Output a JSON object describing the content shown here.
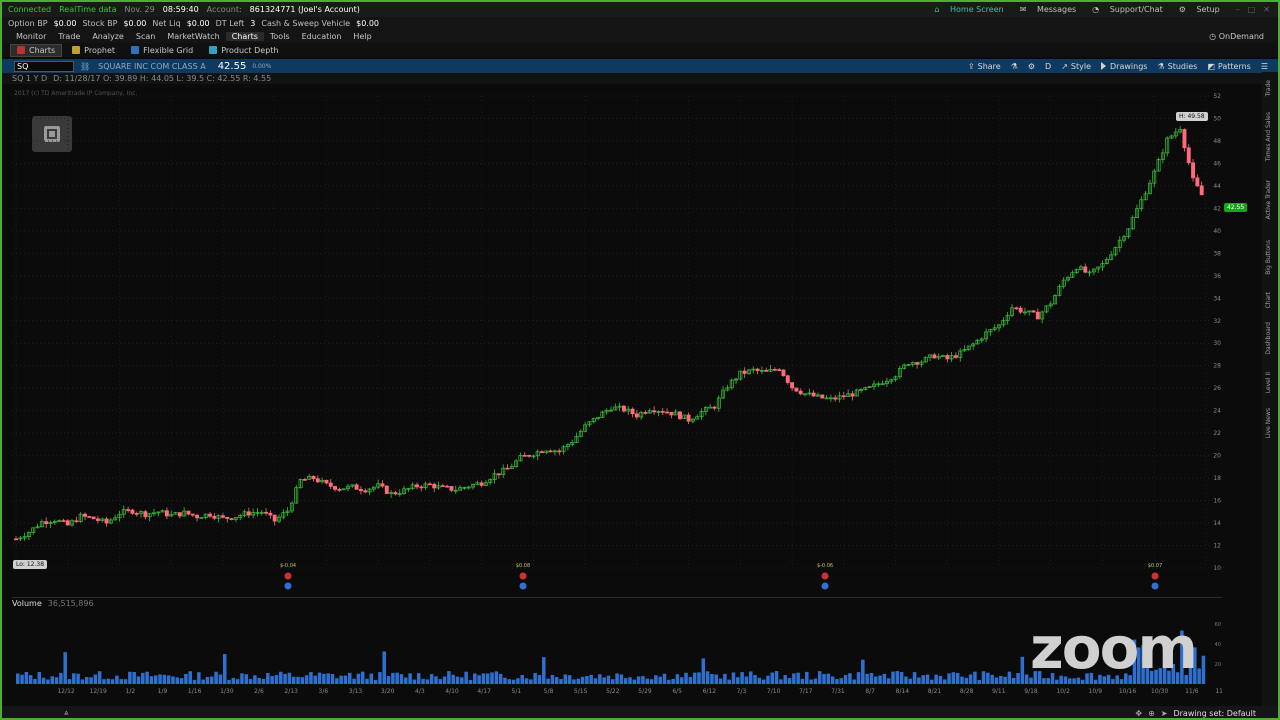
{
  "status": {
    "connected": "Connected",
    "realtime": "RealTime data",
    "datetime": "Nov. 29",
    "time": "08:59:40",
    "account_label": "Account:",
    "account": "861324771 (Joel's Account)",
    "home_screen": "Home Screen",
    "messages": "Messages",
    "support": "Support/Chat",
    "setup": "Setup"
  },
  "bp": {
    "option_bp_label": "Option BP",
    "option_bp": "$0.00",
    "stock_bp_label": "Stock BP",
    "stock_bp": "$0.00",
    "net_liq_label": "Net Liq",
    "net_liq": "$0.00",
    "dt_left_label": "DT Left",
    "dt_left": "3",
    "cash_label": "Cash & Sweep Vehicle",
    "cash": "$0.00"
  },
  "menu": {
    "items": [
      "Monitor",
      "Trade",
      "Analyze",
      "Scan",
      "MarketWatch",
      "Charts",
      "Tools",
      "Education",
      "Help"
    ],
    "ondemand": "OnDemand"
  },
  "subtabs": {
    "items": [
      "Charts",
      "Prophet",
      "Flexible Grid",
      "Product Depth"
    ]
  },
  "chartbar": {
    "symbol": "SQ",
    "description": "SQUARE INC COM CLASS A",
    "last": "42.55",
    "change": "0.00%",
    "share": "Share",
    "style": "Style",
    "drawings": "Drawings",
    "studies": "Studies",
    "patterns": "Patterns",
    "period_code": "D"
  },
  "desc": {
    "period": "SQ 1 Y D",
    "ohlc": "D: 11/28/17   O: 39.89   H: 44.05   L: 39.5   C: 42.55   R: 4.55",
    "copyright": "2017 (c) TD Ameritrade IP Company, Inc."
  },
  "chart_data": {
    "type": "candlestick",
    "title": "",
    "symbol": "SQ",
    "ylim": [
      10,
      52
    ],
    "yticks": [
      10,
      12,
      14,
      16,
      18,
      20,
      22,
      24,
      26,
      28,
      30,
      32,
      34,
      36,
      38,
      40,
      42,
      44,
      46,
      48,
      50,
      52
    ],
    "x_ticks": [
      "12/12",
      "12/19",
      "1/2",
      "1/9",
      "1/16",
      "1/30",
      "2/6",
      "2/13",
      "3/6",
      "3/13",
      "3/20",
      "4/3",
      "4/10",
      "4/17",
      "5/1",
      "5/8",
      "5/15",
      "5/22",
      "5/29",
      "6/5",
      "6/12",
      "7/3",
      "7/10",
      "7/17",
      "7/31",
      "8/7",
      "8/14",
      "8/21",
      "8/28",
      "9/11",
      "9/18",
      "10/2",
      "10/9",
      "10/16",
      "10/30",
      "11/6",
      "11/20"
    ],
    "high_label": "H: 49.58",
    "low_label": "Lo: 12.38",
    "last_label": "42.55",
    "high": 49.58,
    "low": 12.38,
    "last": 42.55,
    "close_path": [
      12.6,
      13.2,
      14.1,
      14.3,
      13.8,
      14.6,
      14.4,
      14.0,
      14.9,
      15.1,
      14.8,
      15.0,
      14.7,
      14.9,
      14.6,
      14.8,
      14.4,
      14.6,
      14.9,
      15.0,
      14.2,
      15.1,
      17.8,
      18.0,
      17.4,
      17.1,
      17.2,
      17.0,
      17.3,
      16.6,
      16.9,
      17.3,
      17.4,
      17.1,
      17.0,
      17.3,
      17.6,
      18.3,
      18.8,
      19.8,
      20.2,
      20.6,
      20.4,
      21.3,
      22.6,
      23.5,
      24.3,
      24.1,
      23.6,
      24.2,
      24.0,
      23.7,
      23.2,
      23.9,
      24.4,
      26.2,
      27.3,
      27.6,
      27.4,
      27.8,
      26.1,
      25.5,
      25.2,
      25.0,
      25.3,
      25.6,
      26.0,
      26.6,
      27.2,
      28.3,
      28.4,
      28.9,
      28.6,
      29.1,
      29.9,
      30.9,
      31.6,
      33.2,
      32.8,
      32.4,
      33.6,
      35.6,
      36.8,
      36.1,
      37.0,
      38.6,
      40.3,
      42.7,
      45.2,
      48.1,
      49.2,
      44.5,
      42.55
    ],
    "dividend_markers": [
      "$-0.04",
      "$0.08",
      "$-0.06",
      "$0.07"
    ],
    "volume_label": "Volume",
    "volume_value": "36,515,896",
    "volume_unit": "millions",
    "volume_yticks": [
      20,
      40,
      60
    ]
  },
  "sidebar": {
    "labels": [
      "Trade",
      "Times And Sales",
      "Active Trader",
      "Big Buttons",
      "Chart",
      "Dashboard",
      "Level II",
      "Live News"
    ]
  },
  "bottom": {
    "drawing_set": "Drawing set: Default"
  },
  "zoom": {
    "logo_text": "zoom"
  },
  "colors": {
    "up": "#3cc13c",
    "down": "#ff6b7d",
    "accent": "#4caf32",
    "chartbar": "#0f3a5f"
  }
}
